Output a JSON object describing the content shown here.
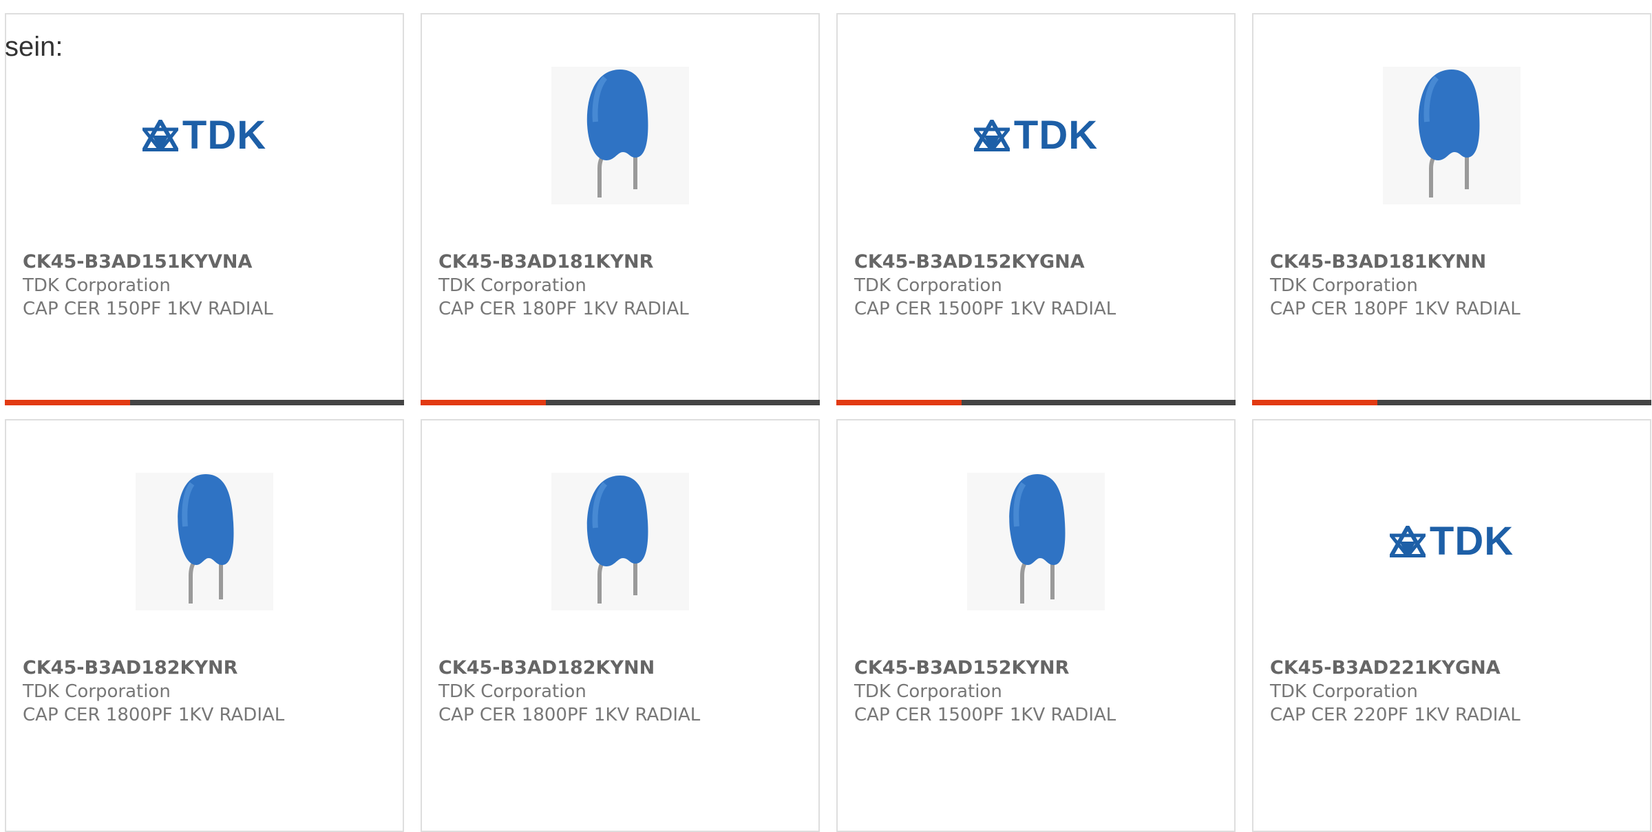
{
  "intro_text": "sein:",
  "colors": {
    "accent_bar": "#e23a12",
    "bar_track": "#444444",
    "brand_blue": "#1d5fa7",
    "capacitor_blue": "#2f73c4"
  },
  "products": [
    {
      "part_number": "CK45-B3AD151KYVNA",
      "manufacturer": "TDK Corporation",
      "description": "CAP CER 150PF 1KV RADIAL",
      "image": "tdk-logo",
      "logo_text": "TDK",
      "progress_bar": true
    },
    {
      "part_number": "CK45-B3AD181KYNR",
      "manufacturer": "TDK Corporation",
      "description": "CAP CER 180PF 1KV RADIAL",
      "image": "capacitor",
      "progress_bar": true
    },
    {
      "part_number": "CK45-B3AD152KYGNA",
      "manufacturer": "TDK Corporation",
      "description": "CAP CER 1500PF 1KV RADIAL",
      "image": "tdk-logo",
      "logo_text": "TDK",
      "progress_bar": true
    },
    {
      "part_number": "CK45-B3AD181KYNN",
      "manufacturer": "TDK Corporation",
      "description": "CAP CER 180PF 1KV RADIAL",
      "image": "capacitor",
      "progress_bar": true
    },
    {
      "part_number": "CK45-B3AD182KYNR",
      "manufacturer": "TDK Corporation",
      "description": "CAP CER 1800PF 1KV RADIAL",
      "image": "capacitor",
      "progress_bar": false
    },
    {
      "part_number": "CK45-B3AD182KYNN",
      "manufacturer": "TDK Corporation",
      "description": "CAP CER 1800PF 1KV RADIAL",
      "image": "capacitor",
      "progress_bar": false
    },
    {
      "part_number": "CK45-B3AD152KYNR",
      "manufacturer": "TDK Corporation",
      "description": "CAP CER 1500PF 1KV RADIAL",
      "image": "capacitor",
      "progress_bar": false
    },
    {
      "part_number": "CK45-B3AD221KYGNA",
      "manufacturer": "TDK Corporation",
      "description": "CAP CER 220PF 1KV RADIAL",
      "image": "tdk-logo",
      "logo_text": "TDK",
      "progress_bar": false
    }
  ]
}
